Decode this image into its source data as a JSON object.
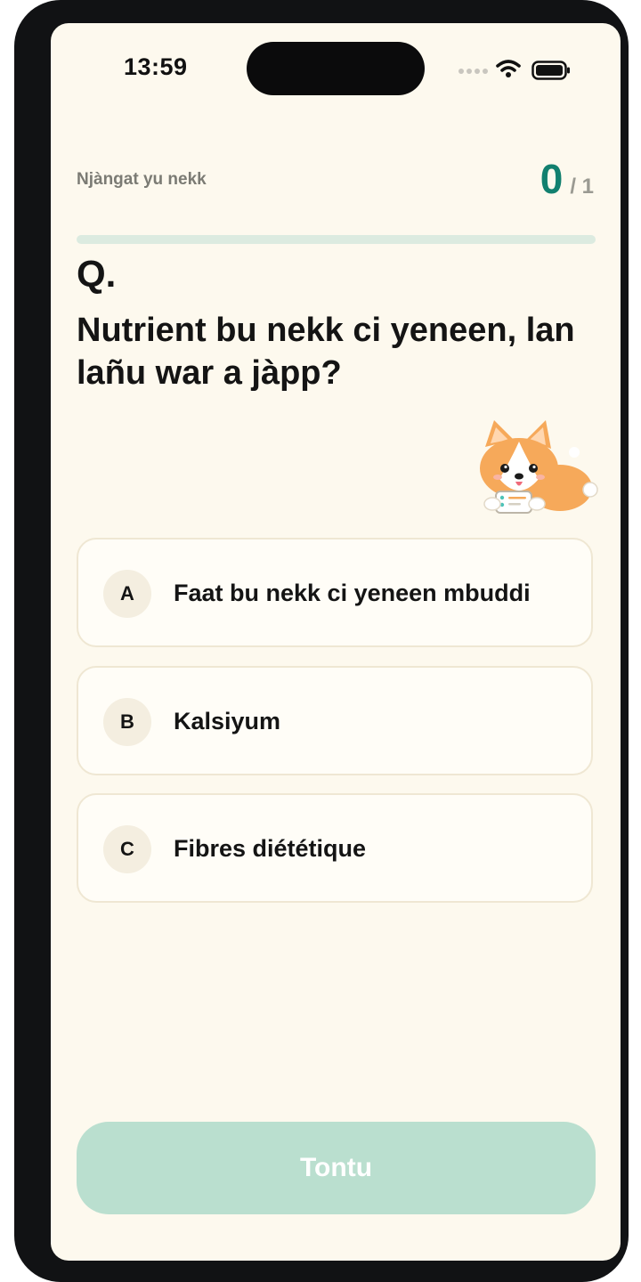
{
  "status_bar": {
    "time": "13:59"
  },
  "header": {
    "quiz_label": "Njàngat yu nekk",
    "score_current": "0",
    "score_total": "/ 1",
    "progress_fraction": 0
  },
  "question": {
    "marker": "Q.",
    "text": "Nutrient bu nekk ci yeneen, lan lañu war a jàpp?"
  },
  "options": [
    {
      "letter": "A",
      "text": "Faat bu nekk ci yeneen mbuddi"
    },
    {
      "letter": "B",
      "text": "Kalsiyum"
    },
    {
      "letter": "C",
      "text": "Fibres diététique"
    }
  ],
  "submit_label": "Tontu",
  "colors": {
    "accent": "#12806f",
    "background": "#fdf9ee",
    "submit_disabled": "#badfcf"
  },
  "icons": [
    "cellular-signal-icon",
    "wifi-icon",
    "battery-icon",
    "corgi-mascot"
  ]
}
